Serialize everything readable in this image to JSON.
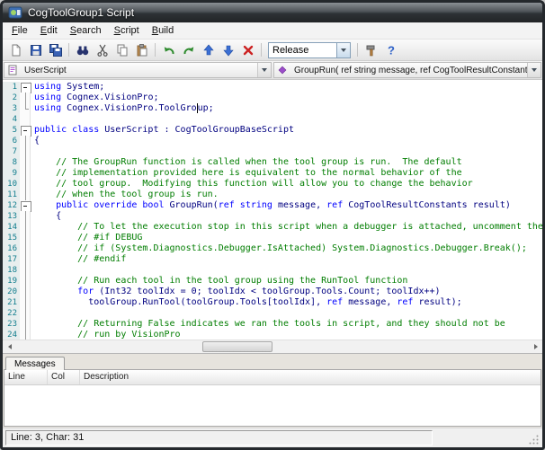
{
  "window": {
    "title": "CogToolGroup1 Script"
  },
  "menu": {
    "items": [
      "File",
      "Edit",
      "Search",
      "Script",
      "Build"
    ]
  },
  "toolbar": {
    "release_label": "Release",
    "icons": [
      "new-script",
      "save",
      "save-all",
      "find",
      "cut",
      "copy",
      "paste",
      "undo",
      "redo",
      "move-up",
      "move-down",
      "delete",
      "chevron-down",
      "build",
      "help"
    ]
  },
  "navbar": {
    "object_label": "UserScript",
    "method_label": "GroupRun( ref string message,  ref CogToolResultConstants result)"
  },
  "editor": {
    "lines": [
      {
        "n": 1,
        "f": "box",
        "segs": [
          {
            "t": "kw",
            "s": "using"
          },
          {
            "t": "pl",
            "s": " System;"
          }
        ]
      },
      {
        "n": 2,
        "f": "line",
        "segs": [
          {
            "t": "kw",
            "s": "using"
          },
          {
            "t": "pl",
            "s": " Cognex.VisionPro;"
          }
        ]
      },
      {
        "n": 3,
        "f": "end",
        "segs": [
          {
            "t": "kw",
            "s": "using"
          },
          {
            "t": "pl",
            "s": " Cognex.VisionPro.ToolGro"
          },
          {
            "t": "caret",
            "s": ""
          },
          {
            "t": "pl",
            "s": "up;"
          }
        ]
      },
      {
        "n": 4,
        "f": "",
        "segs": []
      },
      {
        "n": 5,
        "f": "box",
        "segs": [
          {
            "t": "kw",
            "s": "public class"
          },
          {
            "t": "pl",
            "s": " UserScript : CogToolGroupBaseScript"
          }
        ]
      },
      {
        "n": 6,
        "f": "line",
        "segs": [
          {
            "t": "pl",
            "s": "{"
          }
        ]
      },
      {
        "n": 7,
        "f": "line",
        "segs": []
      },
      {
        "n": 8,
        "f": "line",
        "segs": [
          {
            "t": "cm",
            "s": "    // The GroupRun function is called when the tool group is run.  The default"
          }
        ]
      },
      {
        "n": 9,
        "f": "line",
        "segs": [
          {
            "t": "cm",
            "s": "    // implementation provided here is equivalent to the normal behavior of the"
          }
        ]
      },
      {
        "n": 10,
        "f": "line",
        "segs": [
          {
            "t": "cm",
            "s": "    // tool group.  Modifying this function will allow you to change the behavior"
          }
        ]
      },
      {
        "n": 11,
        "f": "line",
        "segs": [
          {
            "t": "cm",
            "s": "    // when the tool group is run."
          }
        ]
      },
      {
        "n": 12,
        "f": "box",
        "segs": [
          {
            "t": "kw",
            "s": "    public override bool"
          },
          {
            "t": "pl",
            "s": " GroupRun("
          },
          {
            "t": "kw",
            "s": "ref string"
          },
          {
            "t": "pl",
            "s": " message, "
          },
          {
            "t": "kw",
            "s": "ref"
          },
          {
            "t": "pl",
            "s": " CogToolResultConstants result)"
          }
        ]
      },
      {
        "n": 13,
        "f": "line",
        "segs": [
          {
            "t": "pl",
            "s": "    {"
          }
        ]
      },
      {
        "n": 14,
        "f": "line",
        "segs": [
          {
            "t": "cm",
            "s": "        // To let the execution stop in this script when a debugger is attached, uncomment the"
          }
        ]
      },
      {
        "n": 15,
        "f": "line",
        "segs": [
          {
            "t": "cm",
            "s": "        // #if DEBUG"
          }
        ]
      },
      {
        "n": 16,
        "f": "line",
        "segs": [
          {
            "t": "cm",
            "s": "        // if (System.Diagnostics.Debugger.IsAttached) System.Diagnostics.Debugger.Break();"
          }
        ]
      },
      {
        "n": 17,
        "f": "line",
        "segs": [
          {
            "t": "cm",
            "s": "        // #endif"
          }
        ]
      },
      {
        "n": 18,
        "f": "line",
        "segs": []
      },
      {
        "n": 19,
        "f": "line",
        "segs": [
          {
            "t": "cm",
            "s": "        // Run each tool in the tool group using the RunTool function"
          }
        ]
      },
      {
        "n": 20,
        "f": "line",
        "segs": [
          {
            "t": "kw",
            "s": "        for"
          },
          {
            "t": "pl",
            "s": " (Int32 toolIdx = 0; toolIdx < toolGroup.Tools.Count; toolIdx++)"
          }
        ]
      },
      {
        "n": 21,
        "f": "line",
        "segs": [
          {
            "t": "pl",
            "s": "          toolGroup.RunTool(toolGroup.Tools[toolIdx], "
          },
          {
            "t": "kw",
            "s": "ref"
          },
          {
            "t": "pl",
            "s": " message, "
          },
          {
            "t": "kw",
            "s": "ref"
          },
          {
            "t": "pl",
            "s": " result);"
          }
        ]
      },
      {
        "n": 22,
        "f": "line",
        "segs": []
      },
      {
        "n": 23,
        "f": "line",
        "segs": [
          {
            "t": "cm",
            "s": "        // Returning False indicates we ran the tools in script, and they should not be"
          }
        ]
      },
      {
        "n": 24,
        "f": "line",
        "segs": [
          {
            "t": "cm",
            "s": "        // run by VisionPro"
          }
        ]
      }
    ]
  },
  "messages": {
    "tab_label": "Messages",
    "columns": [
      "Line",
      "Col",
      "Description"
    ]
  },
  "status": {
    "caret_position": "Line: 3, Char: 31"
  },
  "colors": {
    "keyword": "#0000ff",
    "comment": "#007d00",
    "plain": "#000080",
    "line_number": "#117d8d"
  }
}
